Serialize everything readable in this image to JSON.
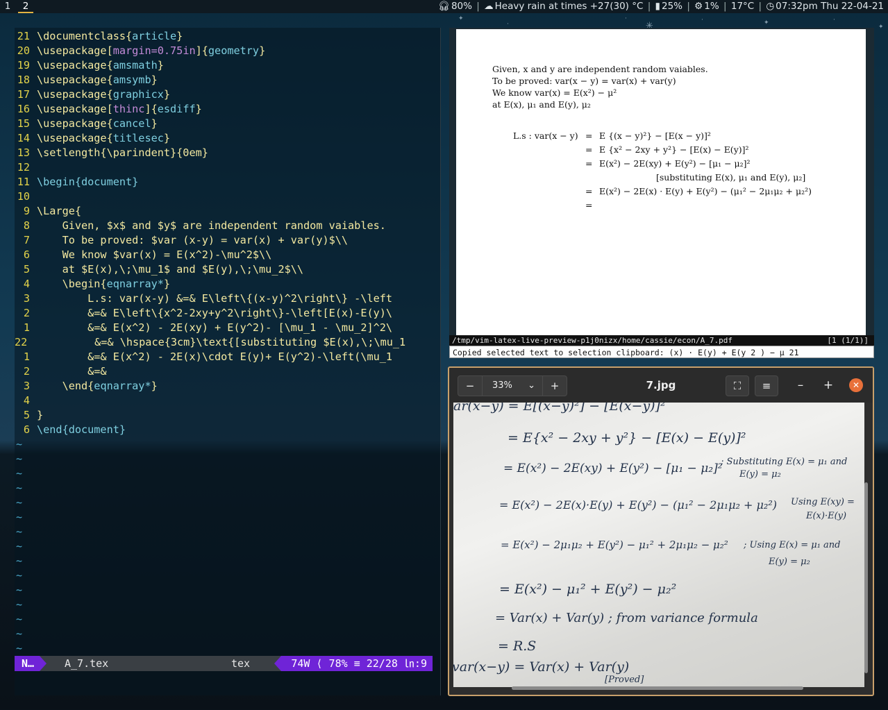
{
  "topbar": {
    "workspaces": [
      "1",
      "2"
    ],
    "active_workspace": "2",
    "volume": "80%",
    "weather": "Heavy rain at times +27(30) °C",
    "battery": "25%",
    "cpu": "1%",
    "temp": "17°C",
    "clock": "07:32pm Thu 22-04-21"
  },
  "editor": {
    "lines": [
      {
        "num": "21",
        "code": "\\documentclass{article}"
      },
      {
        "num": "20",
        "code": "\\usepackage[margin=0.75in]{geometry}"
      },
      {
        "num": "19",
        "code": "\\usepackage{amsmath}"
      },
      {
        "num": "18",
        "code": "\\usepackage{amsymb}"
      },
      {
        "num": "17",
        "code": "\\usepackage{graphicx}"
      },
      {
        "num": "16",
        "code": "\\usepackage[thinc]{esdiff}"
      },
      {
        "num": "15",
        "code": "\\usepackage{cancel}"
      },
      {
        "num": "14",
        "code": "\\usepackage{titlesec}"
      },
      {
        "num": "13",
        "code": "\\setlength{\\parindent}{0em}"
      },
      {
        "num": "12",
        "code": ""
      },
      {
        "num": "11",
        "code": "\\begin{document}"
      },
      {
        "num": "10",
        "code": ""
      },
      {
        "num": "9",
        "code": "\\Large{"
      },
      {
        "num": "8",
        "code": "    Given, $x$ and $y$ are independent random vaiables."
      },
      {
        "num": "7",
        "code": "    To be proved: $var (x-y) = var(x) + var(y)$\\\\"
      },
      {
        "num": "6",
        "code": "    We know $var(x) = E(x^2)-\\mu^2$\\\\"
      },
      {
        "num": "5",
        "code": "    at $E(x),\\;\\mu_1$ and $E(y),\\;\\mu_2$\\\\"
      },
      {
        "num": "4",
        "code": "    \\begin{eqnarray*}"
      },
      {
        "num": "3",
        "code": "        L.s: var(x-y) &=& E\\left\\{(x-y)^2\\right\\} -\\left"
      },
      {
        "num": "2",
        "code": "        &=& E\\left\\{x^2-2xy+y^2\\right\\}-\\left[E(x)-E(y)\\"
      },
      {
        "num": "1",
        "code": "        &=& E(x^2) - 2E(xy) + E(y^2)- [\\mu_1 - \\mu_2]^2\\"
      },
      {
        "num": "22",
        "code": "        &=& \\hspace{3cm}\\text{[substituting $E(x),\\;\\mu_1"
      },
      {
        "num": "1",
        "code": "        &=& E(x^2) - 2E(x)\\cdot E(y)+ E(y^2)-\\left(\\mu_1"
      },
      {
        "num": "2",
        "code": "        &=&"
      },
      {
        "num": "3",
        "code": "    \\end{eqnarray*}"
      },
      {
        "num": "4",
        "code": ""
      },
      {
        "num": "5",
        "code": "}"
      },
      {
        "num": "6",
        "code": "\\end{document}"
      }
    ],
    "tilde": "~",
    "status": {
      "mode": "N…",
      "filename": "A_7.tex",
      "filetype": "tex",
      "position": "74W ⟨ 78% ≡ 22/28 ㏑:9"
    }
  },
  "pdf": {
    "text_lines": [
      "Given, x and y are independent random vaiables.",
      "To be proved: var(x − y) = var(x) + var(y)",
      "We know var(x) = E(x²) − μ²",
      "at E(x), μ₁ and E(y), μ₂"
    ],
    "eq_lhs": "L.s : var(x − y)",
    "eq_lines": [
      {
        "rel": "=",
        "rhs": "E {(x − y)²} − [E(x − y)]²"
      },
      {
        "rel": "=",
        "rhs": "E {x² − 2xy + y²} − [E(x) − E(y)]²"
      },
      {
        "rel": "=",
        "rhs": "E(x²) − 2E(xy) + E(y²) − [μ₁ − μ₂]²"
      },
      {
        "rel": "",
        "rhs": "[substituting E(x), μ₁ and E(y), μ₂]"
      },
      {
        "rel": "=",
        "rhs": "E(x²) − 2E(x) · E(y) + E(y²) − (μ₁² − 2μ₁μ₂ + μ₂²)"
      },
      {
        "rel": "=",
        "rhs": ""
      }
    ],
    "path": "/tmp/vim-latex-live-preview-p1j0nizx/home/cassie/econ/A_7.pdf",
    "page_indicator": "[1 (1/1)]",
    "message": "Copied selected text to selection clipboard: (x) · E(y) + E(y 2 ) − μ 21"
  },
  "image_viewer": {
    "zoom": "33%",
    "title": "7.jpg",
    "close_glyph": "✕",
    "handwriting": [
      "ar(x−y) = E[(x−y)²] − [E(x−y)]²",
      "= E{x² − 2xy + y²} − [E(x) − E(y)]²",
      "= E(x²) − 2E(xy) + E(y²) − [μ₁ − μ₂]²",
      "; Substituting E(x) = μ₁ and",
      "E(y) = μ₂",
      "= E(x²) − 2E(x)·E(y) + E(y²) − (μ₁² − 2μ₁μ₂ + μ₂²)",
      "Using E(xy) =",
      "E(x)·E(y)",
      "= E(x²) − 2μ₁μ₂ + E(y²) − μ₁² + 2μ₁μ₂ − μ₂²",
      "; Using E(x) = μ₁ and",
      "E(y) = μ₂",
      "= E(x²) − μ₁² + E(y²) − μ₂²",
      "= Var(x) + Var(y) ; from variance formula",
      "= R.S",
      "var(x−y) = Var(x) + Var(y)",
      "[Proved]"
    ]
  }
}
